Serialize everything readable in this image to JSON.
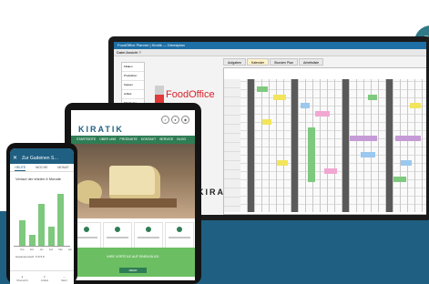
{
  "colors": {
    "band": "#1f5f82",
    "accent": "#2f7d55",
    "brand_red": "#d6222b",
    "bars": "#7ec97e"
  },
  "corner_icon": {
    "name": "refresh-icon",
    "glyph": "↻"
  },
  "monitor": {
    "window_title": "FoodOffice Planner | Kiratik — Dienstplan",
    "menu": "Datei  Ansicht  ?",
    "nav_items": [
      "Filialen",
      "Produktion",
      "Kassen",
      "Artikel",
      "Mitarbeiter",
      "Planung",
      "Auswertung",
      "Einstellungen"
    ],
    "tabs": [
      "Aufgaben",
      "Kalender",
      "Stunden Plan",
      "Arbeitsliste"
    ],
    "logo_text": "FoodOffice",
    "watermark": "KIRATIK"
  },
  "tablet": {
    "logo": "KIRATIK",
    "nav": [
      "STARTSEITE",
      "ÜBER UNS",
      "PRODUKTE",
      "KONTAKT",
      "SERVICE",
      "BLOG"
    ],
    "banner_title": "IHRE VORTEILE AUF EINEN BLICK",
    "banner_button": "MEHR"
  },
  "phone": {
    "title": "Zur Gudeinen S…",
    "close_glyph": "✕",
    "tabs": [
      "HEUTE",
      "WOCHE",
      "MONAT"
    ],
    "caption": "Verlauf der letzten 6 Monate",
    "summary": "Gesamtumsatz: 5.374 €",
    "bottom_nav": [
      "Übersicht",
      "Artikel",
      "Mehr"
    ]
  },
  "chart_data": {
    "type": "bar",
    "categories": [
      "Nov",
      "Dez",
      "Jan",
      "Feb",
      "Mär",
      "Apr"
    ],
    "values": [
      27,
      12,
      45,
      20,
      55,
      0
    ],
    "ylim": [
      0,
      60
    ]
  }
}
